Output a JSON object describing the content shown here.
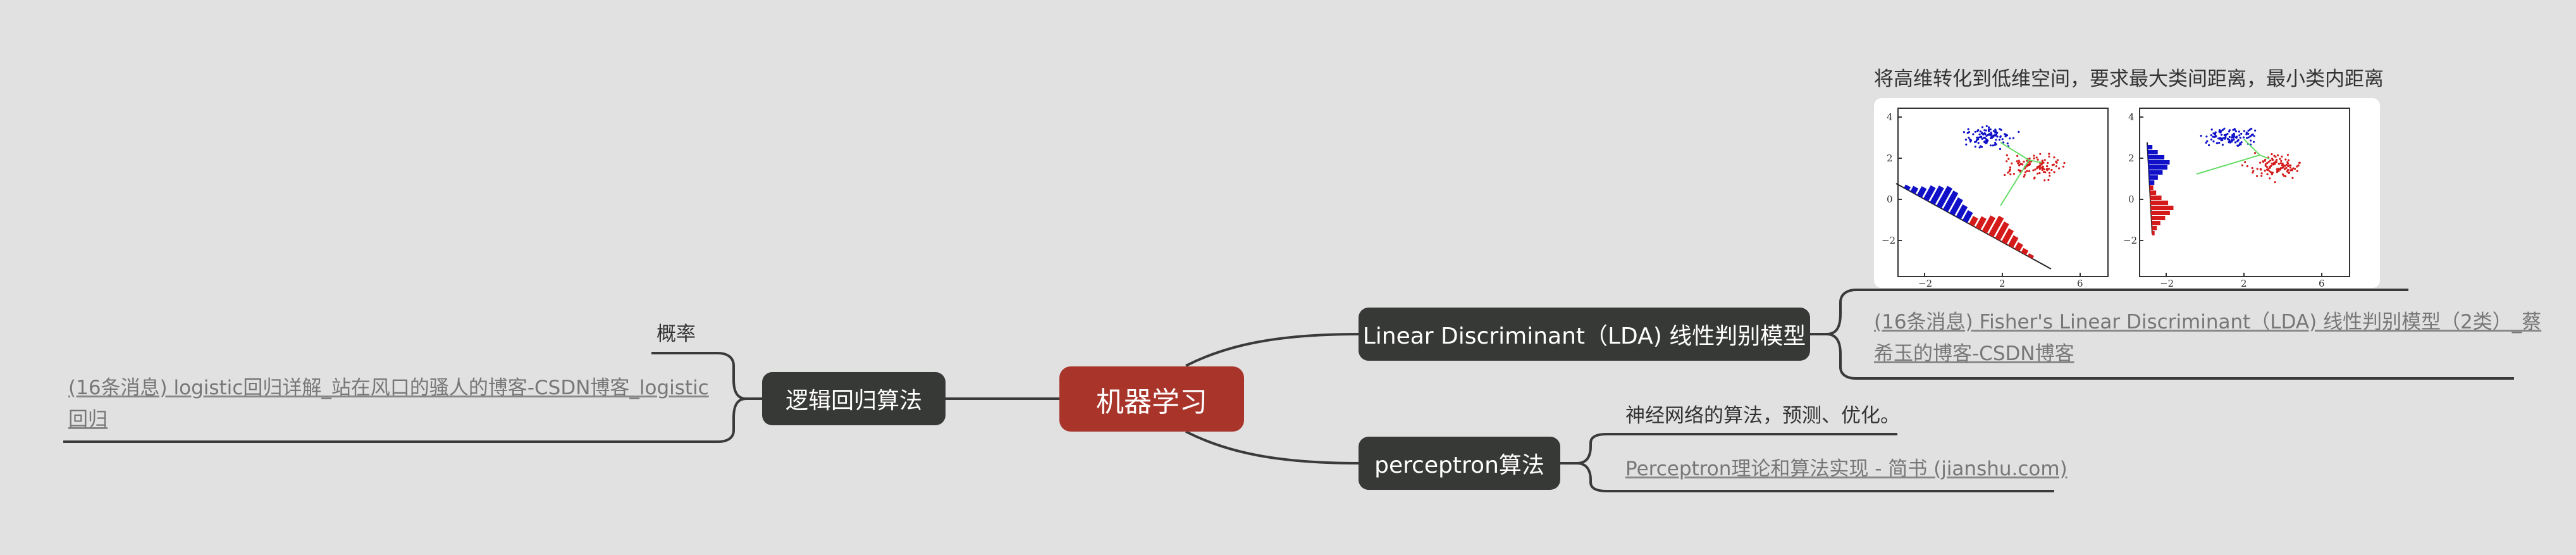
{
  "root": {
    "label": "机器学习"
  },
  "left_branch": {
    "label": "逻辑回归算法",
    "children": {
      "note": "概率",
      "link_lines": [
        "(16条消息) logistic回归详解_站在风口的骚人的博客-CSDN博客_logistic",
        "回归"
      ]
    }
  },
  "right_top_branch": {
    "label": "Linear Discriminant（LDA) 线性判别模型",
    "children": {
      "note": "将高维转化到低维空间，要求最大类间距离，最小类内距离",
      "link_lines": [
        "(16条消息) Fisher's Linear Discriminant（LDA) 线性判别模型（2类）_蔡",
        "希玉的博客-CSDN博客"
      ],
      "figure": {
        "panels": [
          {
            "y_ticks": [
              "4",
              "2",
              "0",
              "−2"
            ],
            "x_ticks": [
              "−2",
              "2",
              "6"
            ]
          },
          {
            "y_ticks": [
              "4",
              "2",
              "0",
              "−2"
            ],
            "x_ticks": [
              "−2",
              "2",
              "6"
            ]
          }
        ],
        "colors": {
          "class_a": "#1010c8",
          "class_b": "#d41a1a",
          "projection": "#66dd66"
        }
      }
    }
  },
  "right_bottom_branch": {
    "label": "perceptron算法",
    "children": {
      "note": "神经网络的算法，预测、优化。",
      "link": "Perceptron理论和算法实现 - 简书 (jianshu.com)"
    }
  },
  "colors": {
    "root": "#a8342a",
    "main_topic": "#373936",
    "background": "#e1e1e1",
    "line": "#3a3a3a"
  }
}
